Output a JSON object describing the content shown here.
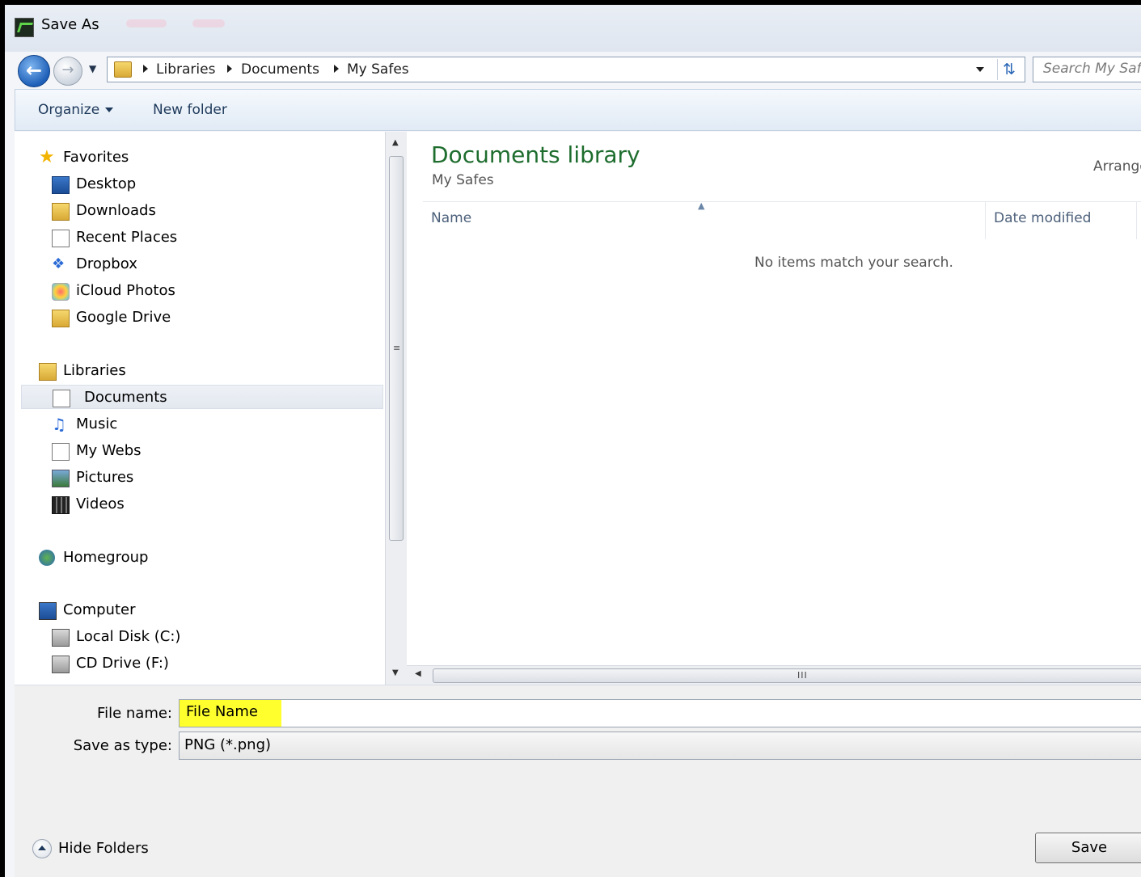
{
  "window": {
    "title": "Save As"
  },
  "nav": {
    "breadcrumb": [
      "Libraries",
      "Documents",
      "My Safes"
    ],
    "search_placeholder": "Search My Safes"
  },
  "toolbar": {
    "organize_label": "Organize",
    "new_folder_label": "New folder"
  },
  "sidebar": {
    "favorites": {
      "label": "Favorites",
      "items": [
        "Desktop",
        "Downloads",
        "Recent Places",
        "Dropbox",
        "iCloud Photos",
        "Google Drive"
      ]
    },
    "libraries": {
      "label": "Libraries",
      "items": [
        "Documents",
        "Music",
        "My Webs",
        "Pictures",
        "Videos"
      ],
      "selected": "Documents"
    },
    "homegroup": {
      "label": "Homegroup"
    },
    "computer": {
      "label": "Computer",
      "items": [
        "Local Disk (C:)",
        "CD Drive (F:)"
      ]
    }
  },
  "content": {
    "title": "Documents library",
    "subtitle": "My Safes",
    "arrange_label": "Arrange",
    "columns": [
      "Name",
      "Date modified"
    ],
    "empty_message": "No items match your search."
  },
  "form": {
    "file_name_label": "File name:",
    "file_name_value": "File Name",
    "save_type_label": "Save as type:",
    "save_type_value": "PNG (*.png)"
  },
  "footer": {
    "hide_folders_label": "Hide Folders",
    "save_label": "Save"
  },
  "colors": {
    "accent_green": "#1e6d2e",
    "highlight": "#ffff2e",
    "toolbar_text": "#1e395b"
  }
}
